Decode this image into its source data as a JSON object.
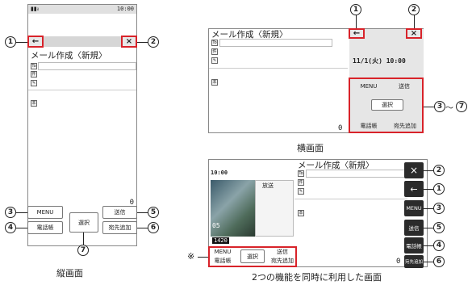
{
  "portrait": {
    "status_time": "10:00",
    "title": "メール作成〈新規〉",
    "back_symbol": "←",
    "close_symbol": "×",
    "count": "0",
    "menu_label": "MENU",
    "phonebook_label": "電話帳",
    "select_label": "選択",
    "send_label": "送信",
    "add_dest_label": "宛先追加",
    "caption": "縦画面"
  },
  "landscape": {
    "title": "メール作成〈新規〉",
    "clock": "11/1(火) 10:00",
    "back_symbol": "←",
    "close_symbol": "×",
    "menu_label": "MENU",
    "send_label": "送信",
    "select_label": "選択",
    "phonebook_label": "電話帳",
    "add_dest_label": "宛先追加",
    "count": "0",
    "caption": "横画面"
  },
  "multi": {
    "status_time": "10:00",
    "title": "メール作成〈新規〉",
    "tv_label": "放送",
    "tv_channel": "05",
    "tv_bottom": "1420",
    "menu_label": "MENU",
    "phonebook_label": "電話帳",
    "select_label": "選択",
    "send_label": "送信",
    "add_dest_label": "宛先追加",
    "close_symbol": "×",
    "back_symbol": "←",
    "side_menu": "MENU",
    "side_send": "送信",
    "side_phonebook": "電話帳",
    "side_add_dest": "宛先追加",
    "count": "0",
    "note_mark": "※",
    "caption": "2つの機能を同時に利用した画面"
  },
  "callouts": {
    "n1": "1",
    "n2": "2",
    "n3": "3",
    "n4": "4",
    "n5": "5",
    "n6": "6",
    "n7": "7",
    "range_sep": "～"
  }
}
